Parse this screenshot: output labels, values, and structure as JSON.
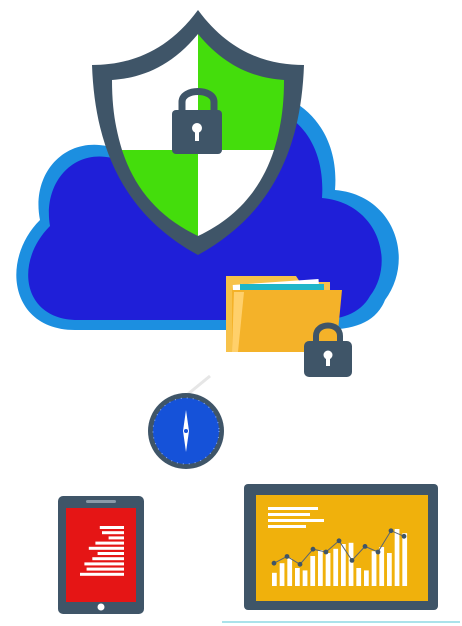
{
  "illustration": {
    "cloud": {
      "icon": "cloud-icon",
      "fill": "#1f1fd8",
      "stroke": "#1c8fe0"
    },
    "shield": {
      "icon": "shield-icon",
      "outline": "#3f5568",
      "fill_light": "#ffffff",
      "fill_green": "#44dd0c",
      "lock_icon": "padlock-icon",
      "lock_color": "#3f5568"
    },
    "folder": {
      "icon": "folder-icon",
      "fill": "#f4b229",
      "back": "#f7c24a",
      "lock_icon": "padlock-icon",
      "lock_color": "#3f5568"
    },
    "compass": {
      "icon": "compass-icon",
      "face": "#1552d9",
      "rim": "#3f5568"
    },
    "tablet": {
      "icon": "tablet-icon",
      "screen": "#e51515",
      "frame": "#3f5568",
      "bars": [
        0.55,
        0.5,
        0.35,
        0.65,
        0.8,
        0.6,
        0.72,
        0.9,
        0.85,
        1.0
      ]
    },
    "laptop": {
      "icon": "laptop-chart-icon",
      "screen": "#f0b10c",
      "frame": "#3f5568",
      "bars": [
        0.22,
        0.38,
        0.46,
        0.3,
        0.26,
        0.5,
        0.6,
        0.55,
        0.62,
        0.7,
        0.72,
        0.3,
        0.26,
        0.58,
        0.65,
        0.55,
        0.95,
        0.88
      ],
      "line": [
        0.3,
        0.42,
        0.28,
        0.55,
        0.5,
        0.7,
        0.35,
        0.6,
        0.5,
        0.88,
        0.78
      ]
    }
  }
}
